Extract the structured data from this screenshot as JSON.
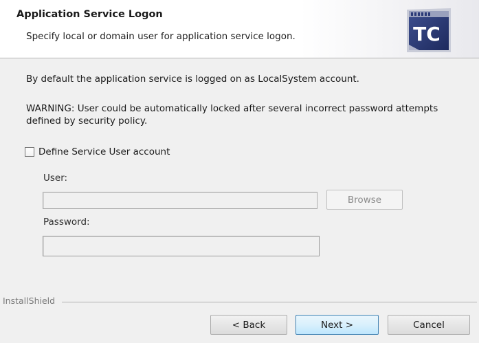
{
  "header": {
    "title": "Application Service Logon",
    "subtitle": "Specify local or domain user for application service logon.",
    "logo_text": "TC"
  },
  "body": {
    "info": "By default the application service is logged on as LocalSystem account.",
    "warning_line1": "WARNING: User could be automatically locked after several incorrect password attempts",
    "warning_line2": "defined by security policy."
  },
  "service_user": {
    "checkbox_label": "Define Service User account",
    "checked": false,
    "user_label": "User:",
    "user_value": "",
    "browse_label": "Browse",
    "password_label": "Password:",
    "password_value": "",
    "enabled": false
  },
  "footer": {
    "brand": "InstallShield",
    "back_label": "< Back",
    "next_label": "Next >",
    "cancel_label": "Cancel"
  },
  "colors": {
    "accent_border": "#3c7fb1",
    "disabled_text": "#8a8a8a",
    "logo_blue": "#2a3a78"
  },
  "icons": {
    "logo": "tc-logo-icon"
  }
}
